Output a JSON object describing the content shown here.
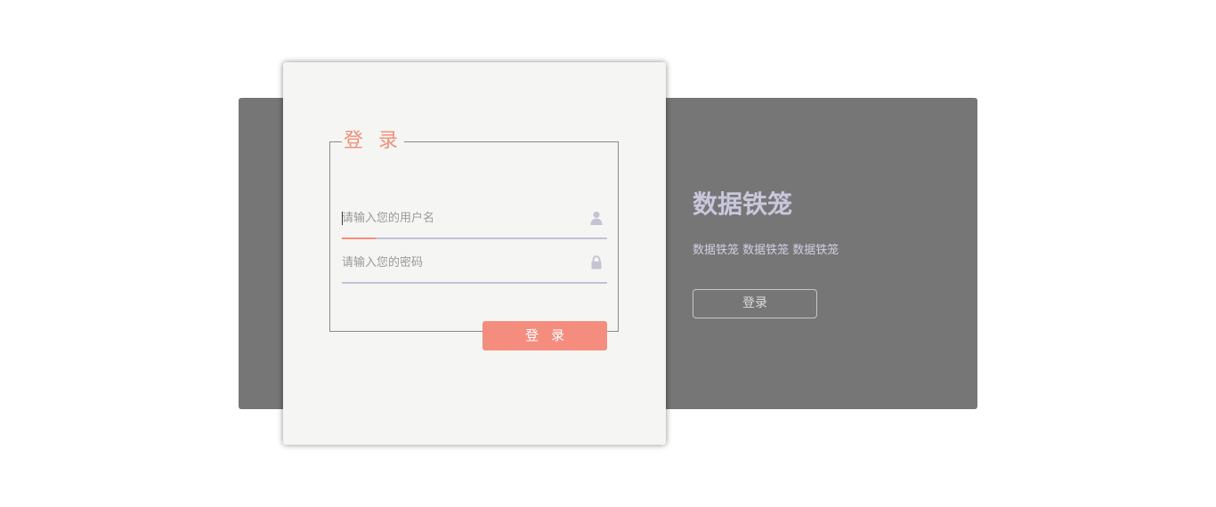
{
  "info_panel": {
    "title": "数据铁笼",
    "description": "数据铁笼 数据铁笼 数据铁笼",
    "login_button_label": "登录"
  },
  "login_form": {
    "legend": "登 录",
    "username": {
      "placeholder": "请输入您的用户名",
      "value": "",
      "icon": "user-icon"
    },
    "password": {
      "placeholder": "请输入您的密码",
      "value": "",
      "icon": "lock-icon"
    },
    "submit_label": "登录"
  },
  "colors": {
    "accent": "#f58d7f",
    "backdrop": "#767676",
    "card": "#f5f5f3",
    "underline": "#c2c0d8",
    "info_title": "#c9c7dc"
  }
}
